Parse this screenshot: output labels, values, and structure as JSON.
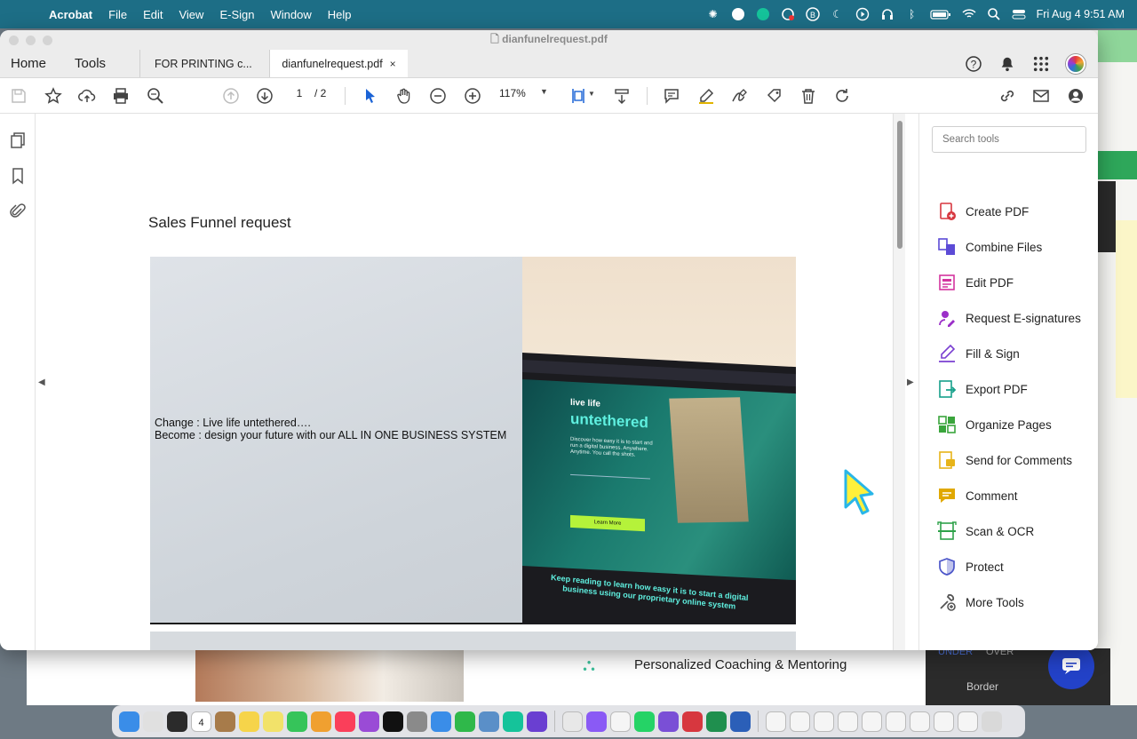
{
  "menubar": {
    "app": "Acrobat",
    "items": [
      "File",
      "Edit",
      "View",
      "E-Sign",
      "Window",
      "Help"
    ],
    "clock": "Fri Aug 4  9:51 AM"
  },
  "window": {
    "title": "dianfunelrequest.pdf"
  },
  "tabs": {
    "home": "Home",
    "tools": "Tools",
    "doc1": "FOR PRINTING c...",
    "doc2": "dianfunelrequest.pdf",
    "close": "×"
  },
  "toolbar": {
    "page_current": "1",
    "page_total": "/ 2",
    "zoom": "117%"
  },
  "document": {
    "heading": "Sales Funnel request",
    "line1": "Change : Live life untethered….",
    "line2": "Become : design your future with our ALL IN ONE BUSINESS SYSTEM",
    "screen_small": "live life",
    "screen_big": "untethered",
    "screen_para": "Discover how easy it is to start and run a digital business. Anywhere. Anytime. You call the shots.",
    "screen_button": "Learn More",
    "screen_footer": "Keep reading to learn how easy it is to start a digital business using our proprietary online system"
  },
  "tools_pane": {
    "search_placeholder": "Search tools",
    "items": [
      {
        "label": "Create PDF",
        "icon": "create-pdf-icon",
        "color": "#d7373f"
      },
      {
        "label": "Combine Files",
        "icon": "combine-files-icon",
        "color": "#5c4bd6"
      },
      {
        "label": "Edit PDF",
        "icon": "edit-pdf-icon",
        "color": "#d4349e"
      },
      {
        "label": "Request E-signatures",
        "icon": "request-esignatures-icon",
        "color": "#9b2fc8"
      },
      {
        "label": "Fill & Sign",
        "icon": "fill-sign-icon",
        "color": "#7a3fd1"
      },
      {
        "label": "Export PDF",
        "icon": "export-pdf-icon",
        "color": "#16a08a"
      },
      {
        "label": "Organize Pages",
        "icon": "organize-pages-icon",
        "color": "#3aa53c"
      },
      {
        "label": "Send for Comments",
        "icon": "send-for-comments-icon",
        "color": "#e7b419"
      },
      {
        "label": "Comment",
        "icon": "comment-icon",
        "color": "#e0a800"
      },
      {
        "label": "Scan & OCR",
        "icon": "scan-ocr-icon",
        "color": "#2fa24a"
      },
      {
        "label": "Protect",
        "icon": "protect-icon",
        "color": "#4b55c9"
      },
      {
        "label": "More Tools",
        "icon": "more-tools-icon",
        "color": "#555555"
      }
    ]
  },
  "background": {
    "coaching": "Personalized Coaching & Mentoring",
    "under": "UNDER",
    "over": "OVER",
    "border": "Border"
  },
  "dock": {
    "calendar_day": "4"
  }
}
